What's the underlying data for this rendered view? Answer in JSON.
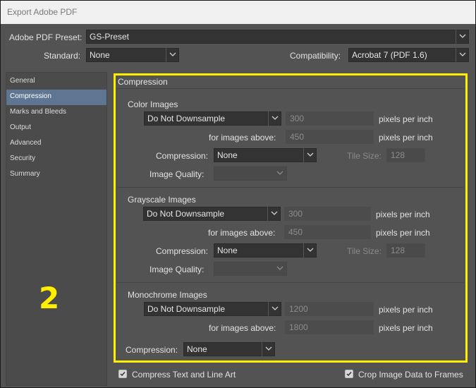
{
  "window": {
    "title": "Export Adobe PDF"
  },
  "preset": {
    "label": "Adobe PDF Preset:",
    "value": "GS-Preset"
  },
  "standard": {
    "label": "Standard:",
    "value": "None"
  },
  "compatibility": {
    "label": "Compatibility:",
    "value": "Acrobat 7 (PDF 1.6)"
  },
  "sidebar": {
    "items": [
      {
        "label": "General"
      },
      {
        "label": "Compression"
      },
      {
        "label": "Marks and Bleeds"
      },
      {
        "label": "Output"
      },
      {
        "label": "Advanced"
      },
      {
        "label": "Security"
      },
      {
        "label": "Summary"
      }
    ],
    "selected": "Compression"
  },
  "annotation": {
    "number": "2"
  },
  "panel": {
    "title": "Compression"
  },
  "color_images": {
    "heading": "Color Images",
    "downsample": "Do Not Downsample",
    "ppi": "300",
    "ppi_unit": "pixels per inch",
    "above_label": "for images above:",
    "above_value": "450",
    "above_unit": "pixels per inch",
    "compression_label": "Compression:",
    "compression": "None",
    "tile_label": "Tile Size:",
    "tile_value": "128",
    "quality_label": "Image Quality:",
    "quality": ""
  },
  "grayscale_images": {
    "heading": "Grayscale Images",
    "downsample": "Do Not Downsample",
    "ppi": "300",
    "ppi_unit": "pixels per inch",
    "above_label": "for images above:",
    "above_value": "450",
    "above_unit": "pixels per inch",
    "compression_label": "Compression:",
    "compression": "None",
    "tile_label": "Tile Size:",
    "tile_value": "128",
    "quality_label": "Image Quality:",
    "quality": ""
  },
  "monochrome_images": {
    "heading": "Monochrome Images",
    "downsample": "Do Not Downsample",
    "ppi": "1200",
    "ppi_unit": "pixels per inch",
    "above_label": "for images above:",
    "above_value": "1800",
    "above_unit": "pixels per inch",
    "compression_label": "Compression:",
    "compression": "None"
  },
  "options": {
    "compress_text": {
      "label": "Compress Text and Line Art",
      "checked": true
    },
    "crop_image": {
      "label": "Crop Image Data to Frames",
      "checked": true
    }
  },
  "colors": {
    "highlight": "#ffee00",
    "selected_item": "#5e7691"
  }
}
